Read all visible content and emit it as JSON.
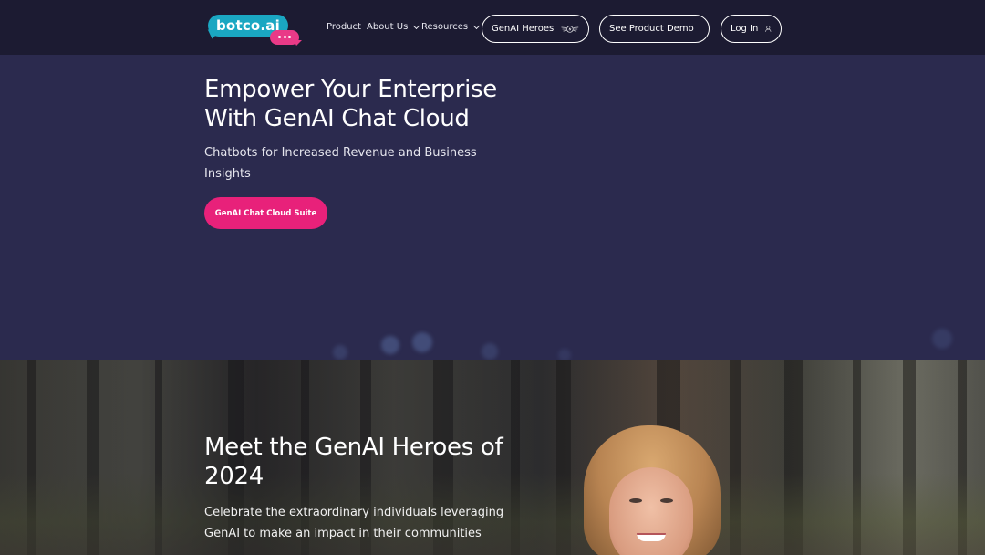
{
  "brand": {
    "logo_text": "botco.ai",
    "colors": {
      "logo_bubble": "#1aa7c2",
      "logo_dots": "#e93a87",
      "nav_bg": "#1c1b32",
      "hero_bg": "#2b2a4e",
      "cta_bg": "#e8217a"
    }
  },
  "nav": {
    "links": [
      {
        "label": "Product",
        "has_dropdown": false
      },
      {
        "label": "About Us",
        "has_dropdown": true
      },
      {
        "label": "Resources",
        "has_dropdown": true
      }
    ],
    "buttons": {
      "heroes": {
        "label": "GenAI Heroes",
        "icon": "winged-bolt-icon"
      },
      "demo": {
        "label": "See Product Demo",
        "icon": "calendar-icon"
      },
      "login": {
        "label": "Log In",
        "icon": "user-icon"
      }
    }
  },
  "hero": {
    "title": "Empower Your Enterprise With GenAI Chat Cloud",
    "subtitle": "Chatbots for Increased Revenue and Business Insights",
    "cta_label": "GenAI Chat Cloud Suite"
  },
  "heroes_section": {
    "title": "Meet the GenAI Heroes of 2024",
    "subtitle": "Celebrate the extraordinary individuals leveraging GenAI to make an impact in their communities"
  }
}
